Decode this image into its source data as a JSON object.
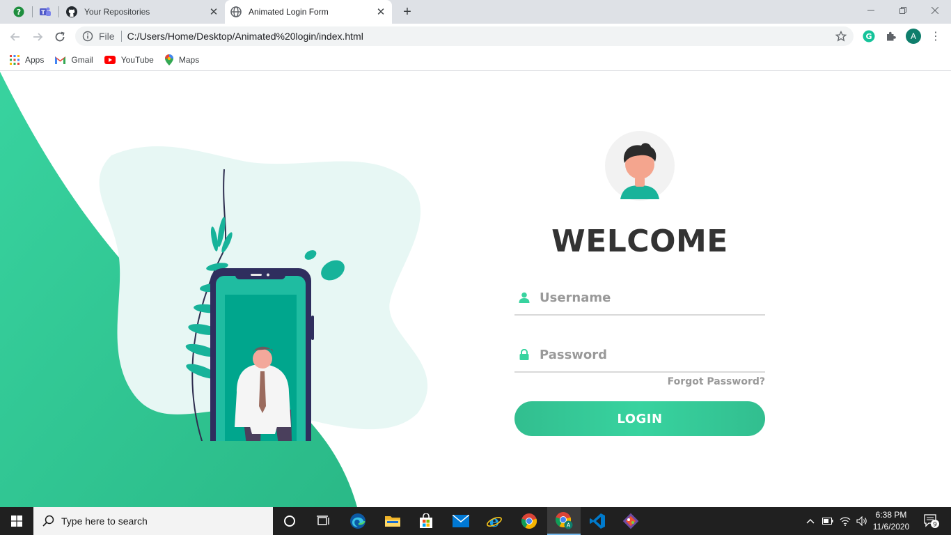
{
  "browser": {
    "tabs": [
      {
        "title": "Your Repositories",
        "icon": "github-icon"
      },
      {
        "title": "Animated Login Form",
        "icon": "globe-icon",
        "active": true
      }
    ],
    "omnibox": {
      "scheme_label": "File",
      "url": "C:/Users/Home/Desktop/Animated%20login/index.html"
    },
    "profile_initial": "A",
    "bookmarks": [
      {
        "label": "Apps",
        "icon": "apps-grid-icon"
      },
      {
        "label": "Gmail",
        "icon": "gmail-icon"
      },
      {
        "label": "YouTube",
        "icon": "youtube-icon"
      },
      {
        "label": "Maps",
        "icon": "maps-pin-icon"
      }
    ]
  },
  "login": {
    "title": "WELCOME",
    "username_placeholder": "Username",
    "password_placeholder": "Password",
    "forgot_label": "Forgot Password?",
    "button_label": "LOGIN"
  },
  "taskbar": {
    "search_placeholder": "Type here to search",
    "time": "6:38 PM",
    "date": "11/6/2020",
    "notification_count": "9",
    "chrome_badge": "A"
  },
  "colors": {
    "accent": "#38d39f",
    "accent_dark": "#32be8f",
    "text_dark": "#333333",
    "muted": "#999999"
  }
}
